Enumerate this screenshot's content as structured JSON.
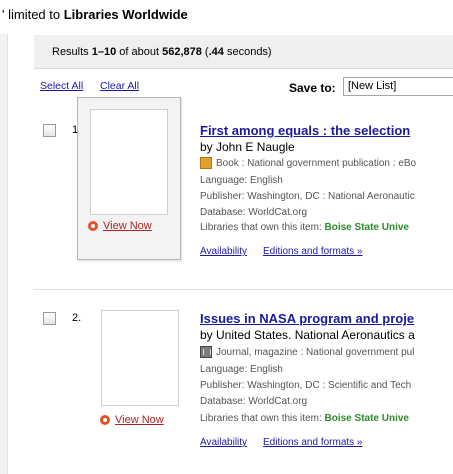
{
  "scope": {
    "prefix": "' limited to ",
    "name": "Libraries Worldwide"
  },
  "results_bar": {
    "text_start": "Results ",
    "range": "1–10",
    "text_mid": " of about ",
    "total": "562,878",
    "time_open": " (",
    "time": ".44",
    "time_close": " seconds)"
  },
  "toolbar": {
    "select_all": "Select All",
    "clear_all": "Clear All",
    "save_to_label": "Save to:",
    "save_to_value": "[New List]"
  },
  "results": [
    {
      "number": "1.",
      "view_now": "View Now",
      "title": "First among equals : the selection",
      "author": "by John E Naugle",
      "format": "Book : National government publication : eBo",
      "language": "Language: English",
      "publisher": "Publisher: Washington, DC : National Aeronautic",
      "database": "Database: WorldCat.org",
      "libraries_prefix": "Libraries that own this item: ",
      "libraries_name": "Boise State Unive",
      "availability": "Availability",
      "editions": "Editions and formats »"
    },
    {
      "number": "2.",
      "view_now": "View Now",
      "title": "Issues in NASA program and proje",
      "author": "by United States. National Aeronautics a",
      "format": "Journal, magazine : National government pul",
      "language": "Language: English",
      "publisher": "Publisher: Washington, DC : Scientific and Tech",
      "database": "Database: WorldCat.org",
      "libraries_prefix": "Libraries that own this item: ",
      "libraries_name": "Boise State Unive",
      "availability": "Availability",
      "editions": "Editions and formats »"
    }
  ]
}
